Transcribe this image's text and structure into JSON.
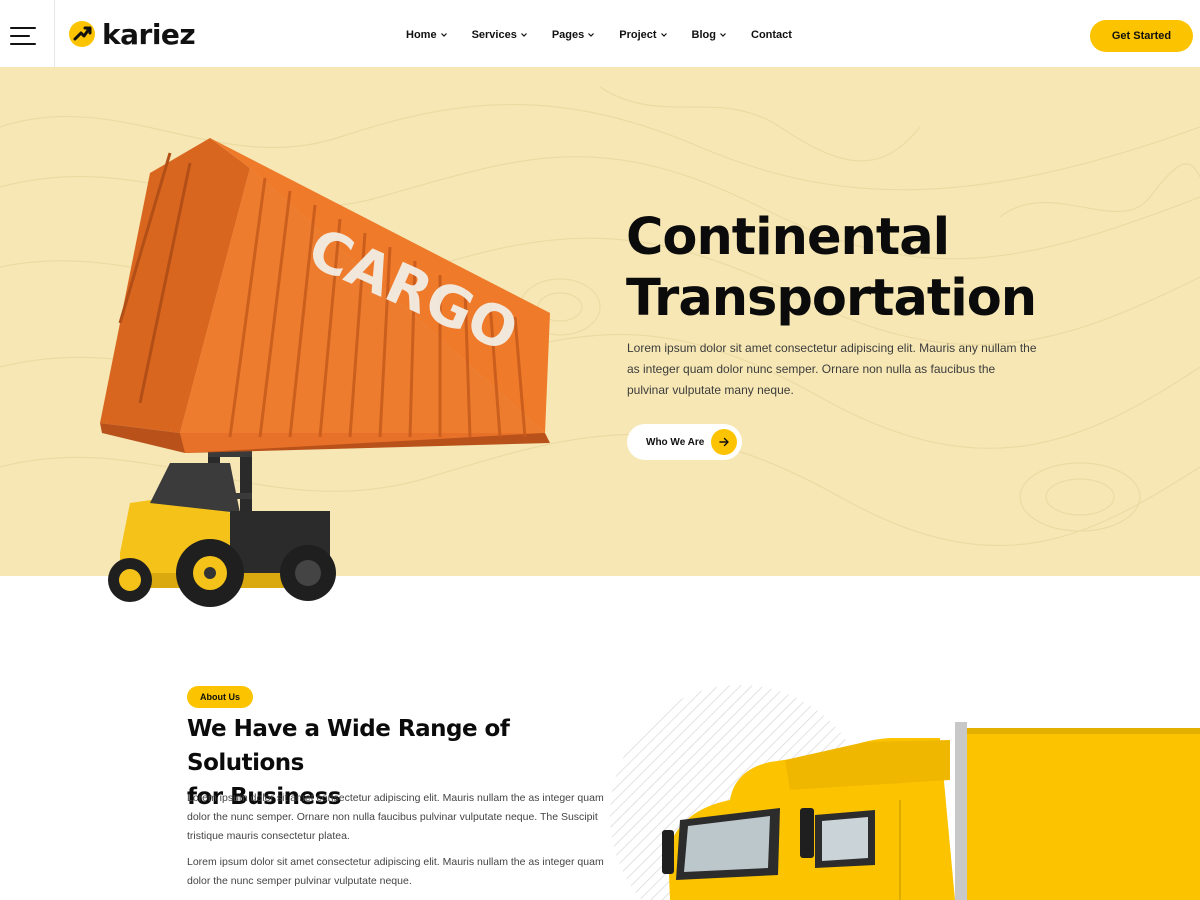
{
  "brand": {
    "name": "kariez"
  },
  "header": {
    "nav": [
      {
        "label": "Home",
        "has_dropdown": true
      },
      {
        "label": "Services",
        "has_dropdown": true
      },
      {
        "label": "Pages",
        "has_dropdown": true
      },
      {
        "label": "Project",
        "has_dropdown": true
      },
      {
        "label": "Blog",
        "has_dropdown": true
      },
      {
        "label": "Contact",
        "has_dropdown": false
      }
    ],
    "cta_label": "Get Started"
  },
  "hero": {
    "title_line1": "Continental",
    "title_line2": "Transportation",
    "description": "Lorem ipsum dolor sit amet consectetur adipiscing elit. Mauris any nullam the as integer quam dolor nunc semper. Ornare non nulla as faucibus the pulvinar vulputate many neque.",
    "button_label": "Who We Are",
    "container_text": "CARGO"
  },
  "about": {
    "badge": "About Us",
    "title_line1": "We Have a Wide Range of Solutions",
    "title_line2": "for Business",
    "paragraph1": "Lorem ipsum dolor sit amet consectetur adipiscing elit. Mauris nullam the as integer quam dolor the nunc semper. Ornare non nulla faucibus pulvinar vulputate neque. The Suscipit tristique mauris consectetur platea.",
    "paragraph2": "Lorem ipsum dolor sit amet consectetur adipiscing elit. Mauris nullam the as integer quam dolor the nunc semper pulvinar vulputate neque."
  },
  "colors": {
    "accent": "#fcc400",
    "hero_bg": "#f6e7b4",
    "text_dark": "#0b0b0b",
    "container_orange": "#ee7a2a"
  },
  "icons": [
    "menu-icon",
    "logo-icon",
    "chevron-down-icon",
    "arrow-right-icon"
  ]
}
